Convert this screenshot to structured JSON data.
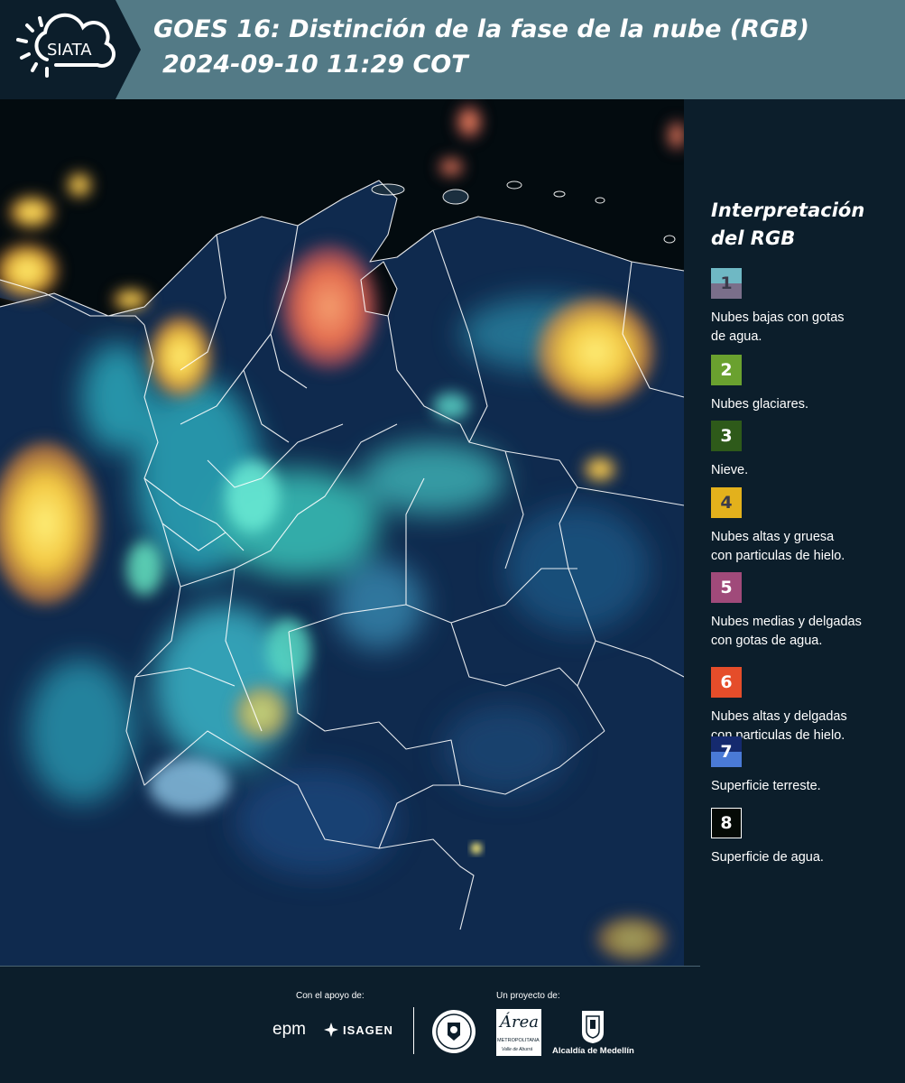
{
  "header": {
    "logo_text": "SIATA",
    "title_line1": "GOES 16: Distinción de la fase de la nube (RGB)",
    "title_line2": "2024-09-10 11:29 COT"
  },
  "legend": {
    "title_line1": "Interpretación",
    "title_line2": "del RGB",
    "items": [
      {
        "number": "1",
        "label_line1": "Nubes bajas con gotas",
        "label_line2": "de agua.",
        "color_top": "#6fb8c4",
        "color_bottom": "#7a6f8a"
      },
      {
        "number": "2",
        "label_line1": "Nubes glaciares.",
        "label_line2": "",
        "color_top": "#6aa12f",
        "color_bottom": "#6aa12f"
      },
      {
        "number": "3",
        "label_line1": "Nieve.",
        "label_line2": "",
        "color_top": "#2e5a1a",
        "color_bottom": "#2e5a1a"
      },
      {
        "number": "4",
        "label_line1": "Nubes altas y gruesa",
        "label_line2": "con particulas de hielo.",
        "color_top": "#e3b11c",
        "color_bottom": "#e3b11c"
      },
      {
        "number": "5",
        "label_line1": "Nubes medias y delgadas",
        "label_line2": "con gotas de agua.",
        "color_top": "#a04a7a",
        "color_bottom": "#a04a7a"
      },
      {
        "number": "6",
        "label_line1": "Nubes altas y delgadas",
        "label_line2": "con particulas de hielo.",
        "color_top": "#e54d2a",
        "color_bottom": "#e54d2a"
      },
      {
        "number": "7",
        "label_line1": "Superficie terreste.",
        "label_line2": "",
        "color_top": "#152a6e",
        "color_bottom": "#4a7ad6"
      },
      {
        "number": "8",
        "label_line1": "Superficie de agua.",
        "label_line2": "",
        "color_top": "#050a06",
        "color_bottom": "#050a06"
      }
    ]
  },
  "footer": {
    "support_caption": "Con el apoyo de:",
    "project_caption": "Un proyecto de:",
    "sponsor_epm": "epm",
    "sponsor_isagen": "ISAGEN",
    "amva_line1": "Área",
    "amva_line2": "METROPOLITANA",
    "amva_line3": "Valle de Aburrá",
    "medellin": "Alcaldía de Medellín"
  },
  "colors": {
    "header_bg": "#537a86",
    "panel_bg": "#0c1e2b",
    "ocean": "#030b0f",
    "land": "#0f2a4e",
    "cloud_thick_ice": "#f2d448",
    "cloud_thin_ice": "#e86a48",
    "cloud_glaciated": "#3fd8c8"
  }
}
